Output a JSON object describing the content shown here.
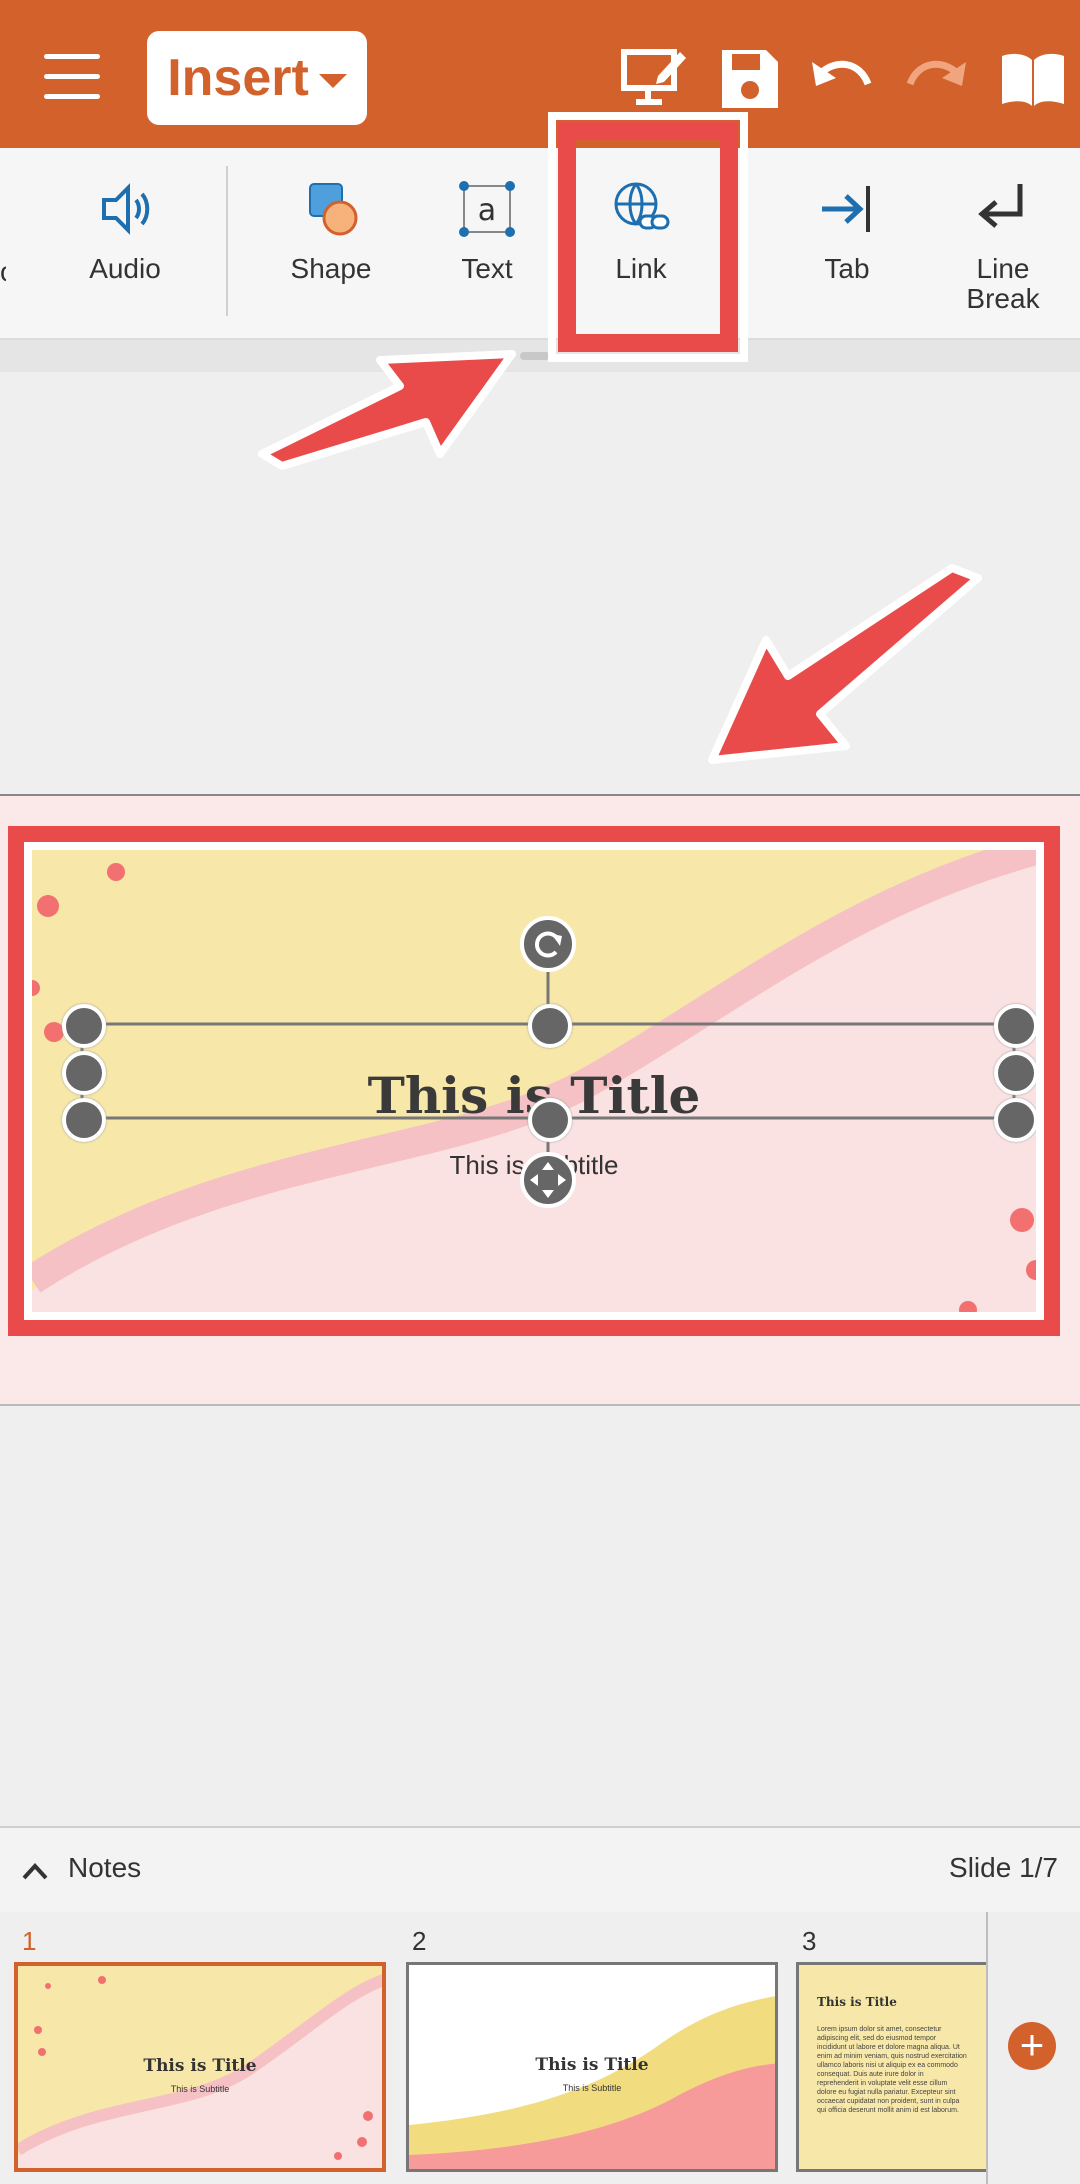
{
  "toolbar": {
    "insert_label": "Insert"
  },
  "ribbon": {
    "items": [
      {
        "label": "Audio",
        "icon": "audio-icon"
      },
      {
        "label": "Shape",
        "icon": "shape-icon"
      },
      {
        "label": "Text",
        "icon": "text-box-icon"
      },
      {
        "label": "Link",
        "icon": "link-icon"
      },
      {
        "label": "Tab",
        "icon": "tab-arrow-icon"
      },
      {
        "label": "Line Break",
        "icon": "line-break-icon"
      }
    ]
  },
  "slide": {
    "title": "This is Title",
    "subtitle": "This is Subtitle"
  },
  "notes_bar": {
    "notes_label": "Notes",
    "slide_counter": "Slide 1/7"
  },
  "thumbnails": [
    {
      "number": "1",
      "title": "This is Title",
      "subtitle": "This is Subtitle"
    },
    {
      "number": "2",
      "title": "This is Title",
      "subtitle": "This is Subtitle"
    },
    {
      "number": "3",
      "title": "This is Title",
      "body": "Lorem ipsum dolor sit amet, consectetur adipiscing elit, sed do eiusmod tempor incididunt ut labore et dolore magna aliqua. Ut enim ad minim veniam, quis nostrud exercitation ullamco laboris nisi ut aliquip ex ea commodo consequat. Duis aute irure dolor in reprehenderit in voluptate velit esse cillum dolore eu fugiat nulla pariatur. Excepteur sint occaecat cupidatat non proident, sunt in culpa qui officia deserunt mollit anim id est laborum."
    }
  ],
  "colors": {
    "accent": "#d2612c",
    "highlight": "#e94b4b",
    "slide_yellow": "#f7e7a8",
    "slide_pink": "#fbe2e2"
  }
}
